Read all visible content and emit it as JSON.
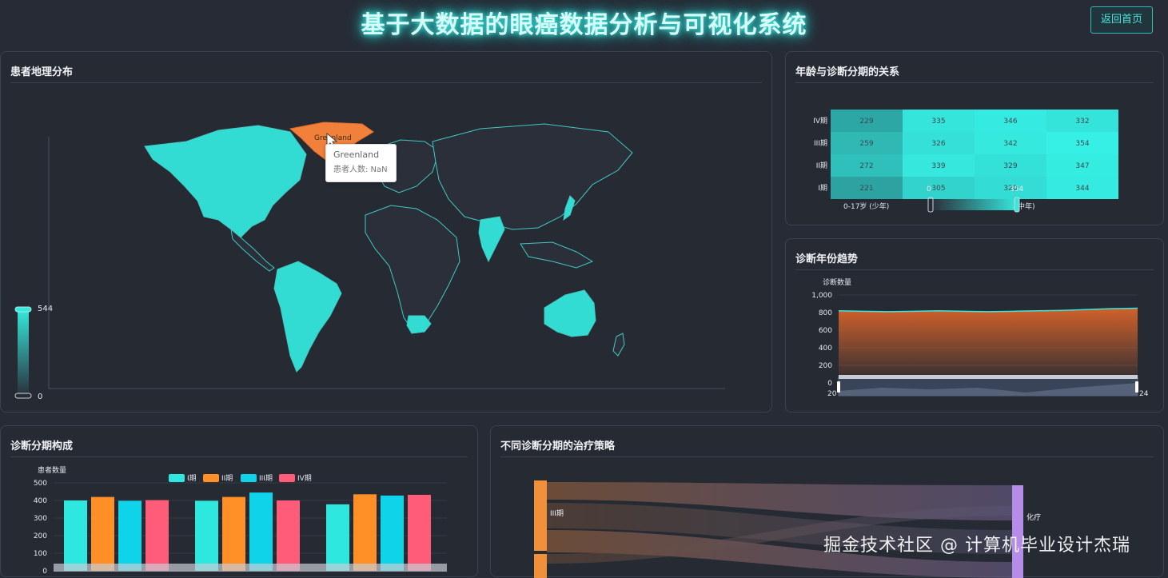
{
  "header": {
    "title": "基于大数据的眼癌数据分析与可视化系统",
    "back_button": "返回首页"
  },
  "map_panel": {
    "title": "患者地理分布",
    "visual_map": {
      "max_label": "544",
      "min_label": "0"
    },
    "highlight": "Greenland",
    "tooltip": {
      "name": "Greenland",
      "value_text": "患者人数: NaN"
    },
    "colors": {
      "land_low": "#2a2f3a",
      "land_high": "#36e8dd",
      "highlight": "#f0803a",
      "border": "#41c9c2"
    }
  },
  "age_stage_panel": {
    "title": "年龄与诊断分期的关系",
    "chart_data": {
      "type": "heatmap",
      "y_categories": [
        "IV期",
        "III期",
        "II期",
        "I期"
      ],
      "x_first_label": "0-17岁 (少年)",
      "x_partial_label": "中年)",
      "values": [
        [
          229,
          335,
          346,
          332
        ],
        [
          259,
          326,
          342,
          354
        ],
        [
          272,
          339,
          329,
          347
        ],
        [
          221,
          305,
          320,
          344
        ]
      ],
      "slider_min": "0",
      "slider_max": "354"
    }
  },
  "trend_panel": {
    "title": "诊断年份趋势",
    "chart_data": {
      "type": "area",
      "ylabel": "诊断数量",
      "y_ticks": [
        "1,000",
        "800",
        "600",
        "400",
        "200",
        "0"
      ],
      "ylim": [
        0,
        1000
      ],
      "values": [
        820,
        815,
        810,
        815,
        820,
        815,
        810,
        815,
        820,
        825,
        835,
        845,
        850
      ],
      "zoom_start_label": "20",
      "zoom_end_label": "24"
    }
  },
  "stage_panel": {
    "title": "诊断分期构成",
    "chart_data": {
      "type": "bar",
      "ylabel": "患者数量",
      "y_ticks": [
        "500",
        "400",
        "300",
        "200",
        "100",
        "0"
      ],
      "ylim": [
        0,
        500
      ],
      "legend": [
        "I期",
        "II期",
        "III期",
        "IV期"
      ],
      "colors": [
        "#2ee8df",
        "#ff8f26",
        "#0fd3e8",
        "#ff5c7a"
      ],
      "groups": [
        [
          400,
          420,
          398,
          402
        ],
        [
          398,
          420,
          445,
          400
        ],
        [
          378,
          435,
          428,
          432
        ]
      ]
    }
  },
  "sankey_panel": {
    "title": "不同诊断分期的治疗策略",
    "left_node": "III期",
    "right_node": "化疗"
  },
  "watermark": "掘金技术社区 @ 计算机毕业设计杰瑞"
}
